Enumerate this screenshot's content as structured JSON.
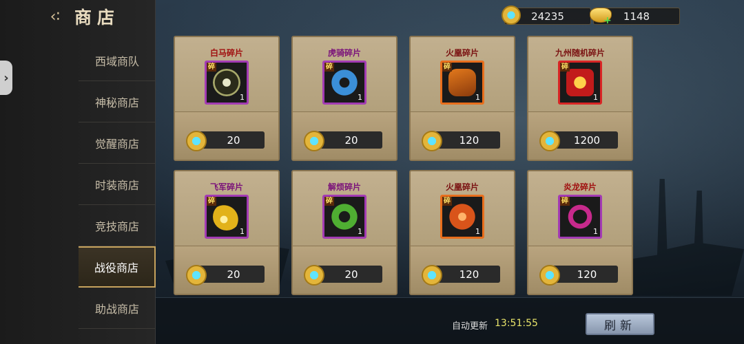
{
  "header": {
    "title": "商店"
  },
  "currency": {
    "gems": "24235",
    "ingots": "1148"
  },
  "menu": [
    {
      "label": "西域商队"
    },
    {
      "label": "神秘商店"
    },
    {
      "label": "觉醒商店"
    },
    {
      "label": "时装商店"
    },
    {
      "label": "竞技商店"
    },
    {
      "label": "战役商店",
      "active": true
    },
    {
      "label": "助战商店"
    }
  ],
  "items": [
    {
      "name": "白马碎片",
      "tag": "碎",
      "qty": "1",
      "price": "20",
      "icon": "necklace-icon"
    },
    {
      "name": "虎骑碎片",
      "tag": "碎",
      "qty": "1",
      "price": "20",
      "icon": "jade-ring-icon"
    },
    {
      "name": "火凰碎片",
      "tag": "碎",
      "qty": "1",
      "price": "120",
      "icon": "belt-icon"
    },
    {
      "name": "九州随机碎片",
      "tag": "碎",
      "qty": "1",
      "price": "1200",
      "icon": "crown-icon"
    },
    {
      "name": "飞军碎片",
      "tag": "碎",
      "qty": "1",
      "price": "20",
      "icon": "golden-hook-icon"
    },
    {
      "name": "解烦碎片",
      "tag": "碎",
      "qty": "1",
      "price": "20",
      "icon": "green-belt-icon"
    },
    {
      "name": "火凰碎片",
      "tag": "碎",
      "qty": "1",
      "price": "120",
      "icon": "fire-amulet-icon"
    },
    {
      "name": "炎龙碎片",
      "tag": "碎",
      "qty": "1",
      "price": "120",
      "icon": "beads-icon"
    }
  ],
  "footer": {
    "auto_refresh_label": "自动更新",
    "auto_refresh_time": "13:51:55",
    "refresh_label": "刷新"
  }
}
